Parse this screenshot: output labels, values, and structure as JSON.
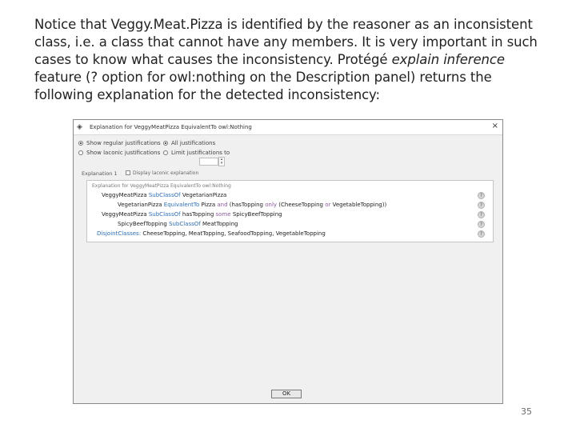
{
  "slide": {
    "line1": "Notice that Veggy.Meat.Pizza is identified by the reasoner as an inconsistent",
    "line2": "class, i.e. a class that cannot have any members. It is very important in such",
    "line3_pre": "cases to know what causes the inconsistency. Protégé ",
    "line3_em": "explain inference",
    "line4": "feature (? option for owl:nothing on the Description panel) returns the",
    "line5": "following explanation for the detected inconsistency:",
    "page_number": "35"
  },
  "dialog": {
    "title": "Explanation for VeggyMeatPizza EquivalentTo owl:Nothing",
    "close_glyph": "×",
    "options": {
      "show_regular": "Show regular justifications",
      "all_justifications": "All justifications",
      "show_laconic": "Show laconic justifications",
      "limit_justifications": "Limit justifications to"
    },
    "explanation_label": "Explanation 1",
    "display_laconic": "Display laconic explanation",
    "panel_header": "Explanation for VeggyMeatPizza EquivalentTo owl:Nothing",
    "axioms": [
      {
        "subject": "VeggyMeatPizza",
        "rel": "SubClassOf",
        "object": "VegetarianPizza",
        "extra": ""
      },
      {
        "subject": "VegetarianPizza",
        "rel": "EquivalentTo",
        "object": "Pizza",
        "and": "and",
        "restr": "(hasTopping",
        "only": "only",
        "rest": "(CheeseTopping",
        "or": "or",
        "tail": "VegetableTopping))"
      },
      {
        "subject": "VeggyMeatPizza",
        "rel": "SubClassOf",
        "object": "hasTopping",
        "some": "some",
        "rest": "SpicyBeefTopping"
      },
      {
        "subject": "SpicyBeefTopping",
        "rel": "SubClassOf",
        "object": "MeatTopping"
      },
      {
        "subject": "DisjointClasses:",
        "rest": "CheeseTopping, MeatTopping, SeafoodTopping, VegetableTopping"
      }
    ],
    "help_glyph": "?",
    "ok_label": "OK"
  }
}
